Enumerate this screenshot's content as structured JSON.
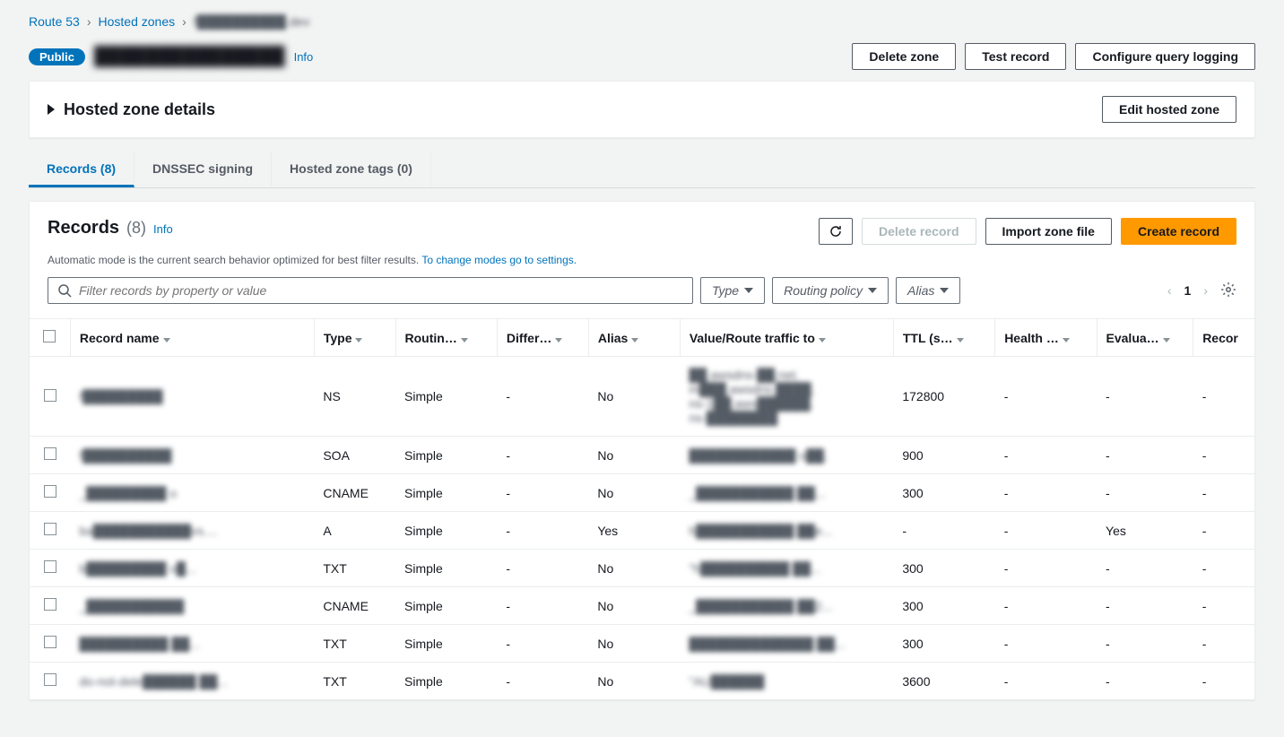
{
  "breadcrumbs": {
    "root": "Route 53",
    "hosted_zones": "Hosted zones",
    "current": "f██████████.dev"
  },
  "header": {
    "badge": "Public",
    "zone_name": "███████████████",
    "info": "Info",
    "delete_zone": "Delete zone",
    "test_record": "Test record",
    "configure_logging": "Configure query logging"
  },
  "details": {
    "title": "Hosted zone details",
    "edit": "Edit hosted zone"
  },
  "tabs": {
    "records": "Records (8)",
    "dnssec": "DNSSEC signing",
    "tags": "Hosted zone tags (0)"
  },
  "records_section": {
    "title": "Records",
    "count": "(8)",
    "info": "Info",
    "subtitle_prefix": "Automatic mode is the current search behavior optimized for best filter results. ",
    "subtitle_link": "To change modes go to settings.",
    "refresh_tooltip": "Refresh",
    "delete_record": "Delete record",
    "import_zone": "Import zone file",
    "create_record": "Create record"
  },
  "filters": {
    "search_placeholder": "Filter records by property or value",
    "type": "Type",
    "routing_policy": "Routing policy",
    "alias": "Alias",
    "page": "1"
  },
  "columns": {
    "name": "Record name",
    "type": "Type",
    "routing": "Routin…",
    "diff": "Differ…",
    "alias": "Alias",
    "value": "Value/Route traffic to",
    "ttl": "TTL (s…",
    "health": "Health …",
    "eval": "Evalua…",
    "rec": "Recor"
  },
  "rows": [
    {
      "name": "f█████████",
      "type": "NS",
      "routing": "Simple",
      "diff": "-",
      "alias": "No",
      "value": "██.awsdns-██.net.\nm███.awsdns.████.\nns-1██.aws██████.\nns-████████",
      "ttl": "172800",
      "health": "-",
      "eval": "-",
      "rec": "-"
    },
    {
      "name": "f██████████",
      "type": "SOA",
      "routing": "Simple",
      "diff": "-",
      "alias": "No",
      "value": "████████████ o██.",
      "ttl": "900",
      "health": "-",
      "eval": "-",
      "rec": "-"
    },
    {
      "name": "_█████████ o",
      "type": "CNAME",
      "routing": "Simple",
      "diff": "-",
      "alias": "No",
      "value": "_███████████ ██...",
      "ttl": "300",
      "health": "-",
      "eval": "-",
      "rec": "-"
    },
    {
      "name": "ba███████████vs....",
      "type": "A",
      "routing": "Simple",
      "diff": "-",
      "alias": "Yes",
      "value": "h███████████ ██e...",
      "ttl": "-",
      "health": "-",
      "eval": "Yes",
      "rec": "-"
    },
    {
      "name": "b█████████ o█...",
      "type": "TXT",
      "routing": "Simple",
      "diff": "-",
      "alias": "No",
      "value": "\"h██████████ ██...",
      "ttl": "300",
      "health": "-",
      "eval": "-",
      "rec": "-"
    },
    {
      "name": "_███████████",
      "type": "CNAME",
      "routing": "Simple",
      "diff": "-",
      "alias": "No",
      "value": "_███████████ ██2...",
      "ttl": "300",
      "health": "-",
      "eval": "-",
      "rec": "-"
    },
    {
      "name": "██████████ ██...",
      "type": "TXT",
      "routing": "Simple",
      "diff": "-",
      "alias": "No",
      "value": "██████████████ ██...",
      "ttl": "300",
      "health": "-",
      "eval": "-",
      "rec": "-"
    },
    {
      "name": "do-not-dele██████ ██...",
      "type": "TXT",
      "routing": "Simple",
      "diff": "-",
      "alias": "No",
      "value": "\"AU██████",
      "ttl": "3600",
      "health": "-",
      "eval": "-",
      "rec": "-"
    }
  ]
}
